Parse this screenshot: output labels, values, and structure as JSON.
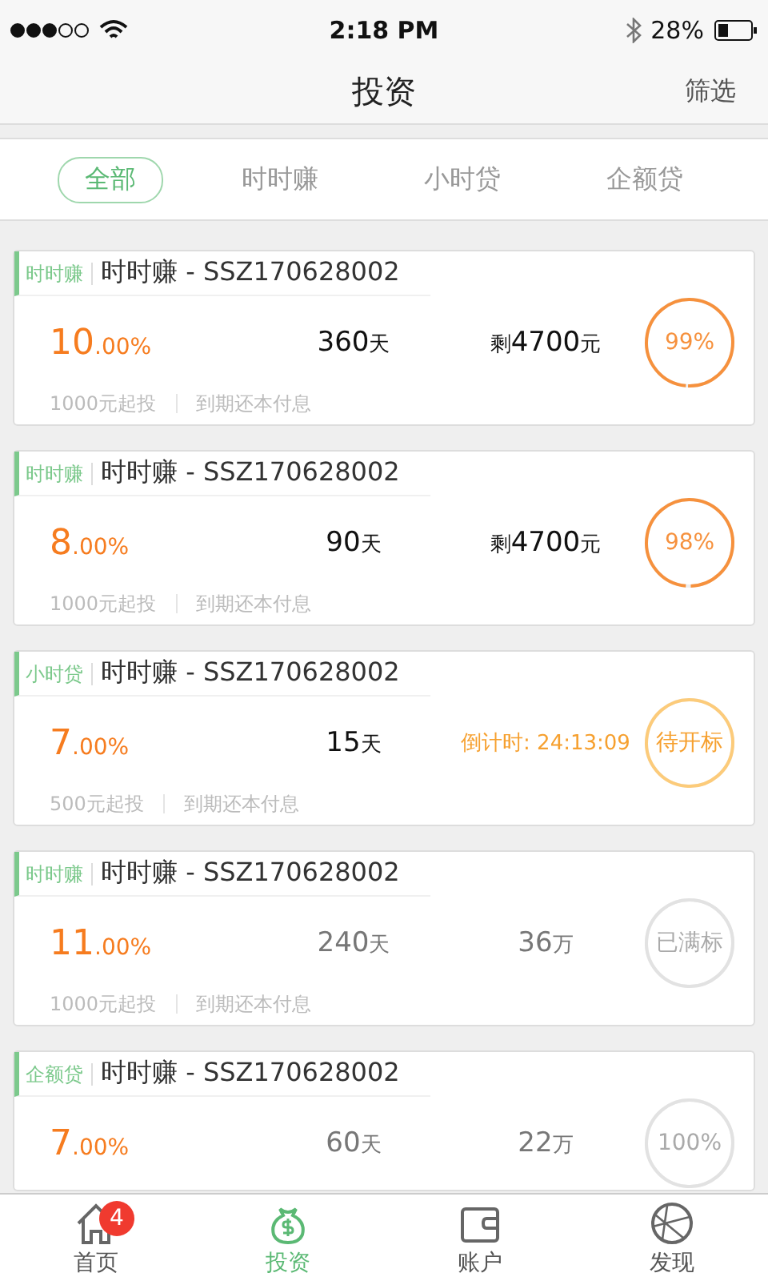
{
  "status_bar": {
    "time": "2:18 PM",
    "battery": "28%"
  },
  "nav": {
    "title": "投资",
    "action": "筛选"
  },
  "filters": [
    {
      "label": "全部",
      "selected": true
    },
    {
      "label": "时时赚",
      "selected": false
    },
    {
      "label": "小时贷",
      "selected": false
    },
    {
      "label": "企额贷",
      "selected": false
    }
  ],
  "products": [
    {
      "kind": "open",
      "tag": "时时赚",
      "title": "时时赚 - SSZ170628002",
      "rate_int": "10",
      "rate_dec": ".00%",
      "term": "360",
      "term_unit": "天",
      "amount_prefix": "剩",
      "amount": "4700",
      "amount_unit": "元",
      "ring": "99%",
      "level": 0.99,
      "min_invest": "1000元起投",
      "repayment": "到期还本付息"
    },
    {
      "kind": "open",
      "tag": "时时赚",
      "title": "时时赚 - SSZ170628002",
      "rate_int": "8",
      "rate_dec": ".00%",
      "term": "90",
      "term_unit": "天",
      "amount_prefix": "剩",
      "amount": "4700",
      "amount_unit": "元",
      "ring": "98%",
      "level": 0.98,
      "min_invest": "1000元起投",
      "repayment": "到期还本付息"
    },
    {
      "kind": "countdown",
      "tag": "小时贷",
      "title": "时时赚 - SSZ170628002",
      "rate_int": "7",
      "rate_dec": ".00%",
      "term": "15",
      "term_unit": "天",
      "amount": "倒计时: 24:13:09",
      "ring": "待开标",
      "min_invest": "500元起投",
      "repayment": "到期还本付息"
    },
    {
      "kind": "full",
      "tag": "时时赚",
      "title": "时时赚 - SSZ170628002",
      "rate_int": "11",
      "rate_dec": ".00%",
      "term": "240",
      "term_unit": "天",
      "amount": "36",
      "amount_unit": "万",
      "ring": "已满标",
      "min_invest": "1000元起投",
      "repayment": "到期还本付息"
    },
    {
      "kind": "full",
      "tag": "企额贷",
      "title": "时时赚 - SSZ170628002",
      "rate_int": "7",
      "rate_dec": ".00%",
      "term": "60",
      "term_unit": "天",
      "amount": "22",
      "amount_unit": "万",
      "ring": "100%"
    }
  ],
  "tab_bar": [
    {
      "label": "首页",
      "badge": "4",
      "selected": false
    },
    {
      "label": "投资",
      "selected": true
    },
    {
      "label": "账户",
      "selected": false
    },
    {
      "label": "发现",
      "selected": false
    }
  ]
}
